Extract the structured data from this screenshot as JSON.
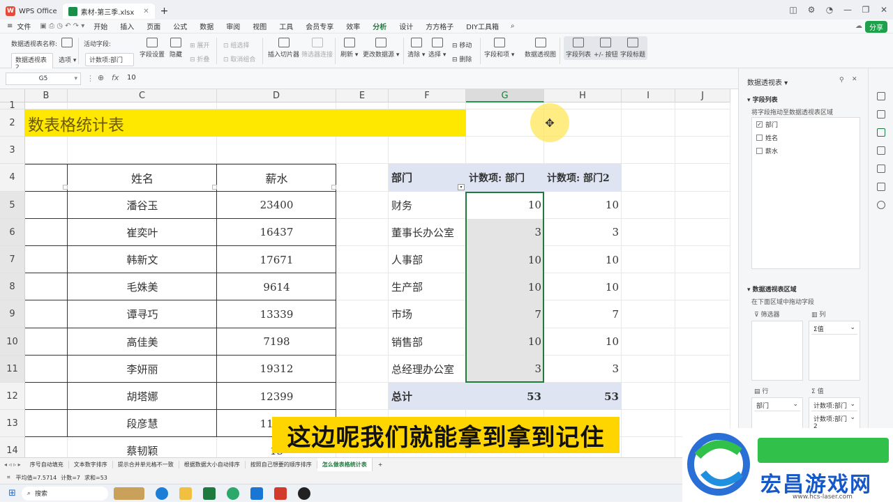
{
  "titlebar": {
    "app_tab": "WPS Office",
    "file_tab": "素材-第三季.xlsx",
    "new_tab": "+",
    "logo_letter": "W"
  },
  "menu": {
    "file": "文件",
    "items": [
      "开始",
      "插入",
      "页面",
      "公式",
      "数据",
      "审阅",
      "视图",
      "工具",
      "会员专享",
      "效率",
      "分析",
      "设计",
      "方方格子",
      "DIY工具箱"
    ],
    "active": "分析",
    "share": "分享"
  },
  "ribbon": {
    "pivot_name_label": "数据透视表名称:",
    "pivot_name_value": "数据透视表2",
    "options": "选项",
    "active_field_label": "活动字段:",
    "active_field_value": "计数项:部门",
    "field_settings": "字段设置",
    "hide": "隐藏",
    "expand": "展开",
    "collapse": "折叠",
    "group_selection": "组选择",
    "ungroup": "取消组合",
    "insert_slicer": "插入切片器",
    "filter_connection": "筛选器连接",
    "refresh": "刷新",
    "change_source": "更改数据源",
    "clear": "清除",
    "select": "选择",
    "move": "移动",
    "delete": "删除",
    "fields_items": "字段和项",
    "pivot_chart": "数据透视图",
    "field_list": "字段列表",
    "plus_minus": "+/- 按钮",
    "field_headers": "字段标题"
  },
  "formula_bar": {
    "cell_ref": "G5",
    "fx": "fx",
    "value": "10"
  },
  "columns": [
    "B",
    "C",
    "D",
    "E",
    "F",
    "G",
    "H",
    "I",
    "J"
  ],
  "active_column": "G",
  "rows": [
    "1",
    "2",
    "3",
    "4",
    "5",
    "6",
    "7",
    "8",
    "9",
    "10",
    "11",
    "12",
    "13",
    "14"
  ],
  "sheet_title": "数表格统计表",
  "table_headers": {
    "name": "姓名",
    "salary": "薪水"
  },
  "employees": [
    {
      "name": "潘谷玉",
      "salary": "23400"
    },
    {
      "name": "崔奕叶",
      "salary": "16437"
    },
    {
      "name": "韩新文",
      "salary": "17671"
    },
    {
      "name": "毛姝美",
      "salary": "9614"
    },
    {
      "name": "谭寻巧",
      "salary": "13339"
    },
    {
      "name": "高佳美",
      "salary": "7198"
    },
    {
      "name": "李妍丽",
      "salary": "19312"
    },
    {
      "name": "胡塔娜",
      "salary": "12399"
    },
    {
      "name": "段彦慧",
      "salary": "11142"
    },
    {
      "name": "蔡韧颖",
      "salary": "13"
    }
  ],
  "pivot": {
    "header_dept": "部门",
    "header_count1": "计数项: 部门",
    "header_count2": "计数项: 部门2",
    "rows": [
      {
        "dept": "财务",
        "c1": "10",
        "c2": "10"
      },
      {
        "dept": "董事长办公室",
        "c1": "3",
        "c2": "3"
      },
      {
        "dept": "人事部",
        "c1": "10",
        "c2": "10"
      },
      {
        "dept": "生产部",
        "c1": "10",
        "c2": "10"
      },
      {
        "dept": "市场",
        "c1": "7",
        "c2": "7"
      },
      {
        "dept": "销售部",
        "c1": "10",
        "c2": "10"
      },
      {
        "dept": "总经理办公室",
        "c1": "3",
        "c2": "3"
      }
    ],
    "total_label": "总计",
    "total_c1": "53",
    "total_c2": "53"
  },
  "panel": {
    "title": "数据透视表",
    "field_list": "字段列表",
    "drag_hint": "将字段拖动至数据透视表区域",
    "fields": [
      {
        "label": "部门",
        "checked": true
      },
      {
        "label": "姓名",
        "checked": false
      },
      {
        "label": "薪水",
        "checked": false
      }
    ],
    "area_title": "数据透视表区域",
    "area_hint": "在下面区域中拖动字段",
    "filters": "筛选器",
    "columns": "列",
    "columns_value": "Σ值",
    "rows": "行",
    "values": "值",
    "rows_value": "部门",
    "values_1": "计数项:部门",
    "values_2": "计数项:部门2"
  },
  "sheet_tabs": [
    "序号自动填充",
    "文本数字排序",
    "提示合并单元格不一致",
    "根据数据大小自动排序",
    "按照自己想要的顺序排序",
    "怎么做表格统计表"
  ],
  "active_sheet": "怎么做表格统计表",
  "status": {
    "average": "平均值=7.5714",
    "count": "计数=7",
    "sum": "求和=53"
  },
  "taskbar": {
    "search": "搜索"
  },
  "subtitle": "这边呢我们就能拿到拿到记住",
  "watermark": {
    "brand": "宏昌游戏网",
    "url": "www.hcs-laser.com"
  }
}
